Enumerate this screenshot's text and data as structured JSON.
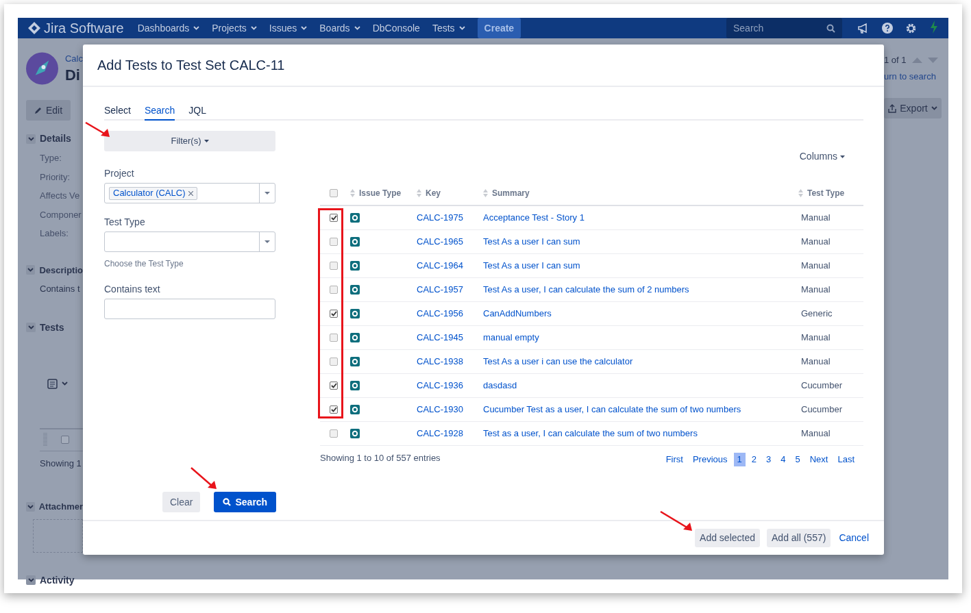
{
  "header": {
    "logo": "Jira Software",
    "nav": [
      {
        "label": "Dashboards",
        "dropdown": true
      },
      {
        "label": "Projects",
        "dropdown": true
      },
      {
        "label": "Issues",
        "dropdown": true
      },
      {
        "label": "Boards",
        "dropdown": true
      },
      {
        "label": "DbConsole",
        "dropdown": false
      },
      {
        "label": "Tests",
        "dropdown": true
      }
    ],
    "create": "Create",
    "search_placeholder": "Search"
  },
  "background": {
    "project_link": "Calc",
    "title": "Di",
    "edit": "Edit",
    "details": "Details",
    "fields": [
      "Type:",
      "Priority:",
      "Affects Ve",
      "Componer",
      "Labels:"
    ],
    "description": "Descriptio",
    "description_text": "Contains t",
    "tests": "Tests",
    "row_checked": false,
    "showing": "Showing 1",
    "attachments": "Attachmer",
    "activity": "Activity",
    "pager": "1 of 1",
    "return_link": "urn to search",
    "export": "Export"
  },
  "dialog": {
    "title": "Add Tests to Test Set CALC-11",
    "tabs": [
      {
        "label": "Select",
        "selected": false
      },
      {
        "label": "Search",
        "selected": true
      },
      {
        "label": "JQL",
        "selected": false
      }
    ],
    "filters_button": "Filter(s)",
    "project": {
      "label": "Project",
      "chip": "Calculator (CALC)"
    },
    "test_type": {
      "label": "Test Type",
      "hint": "Choose the Test Type"
    },
    "contains_text": {
      "label": "Contains text"
    },
    "clear": "Clear",
    "search": "Search",
    "columns_button": "Columns",
    "table": {
      "all_checked": false,
      "columns": [
        "Issue Type",
        "Key",
        "Summary",
        "Test Type"
      ],
      "rows": [
        {
          "checked": true,
          "key": "CALC-1975",
          "summary": "Acceptance Test - Story 1",
          "test_type": "Manual"
        },
        {
          "checked": false,
          "key": "CALC-1965",
          "summary": "Test As a user I can sum",
          "test_type": "Manual"
        },
        {
          "checked": false,
          "key": "CALC-1964",
          "summary": "Test As a user I can sum",
          "test_type": "Manual"
        },
        {
          "checked": false,
          "key": "CALC-1957",
          "summary": "Test As a user, I can calculate the sum of 2 numbers",
          "test_type": "Manual"
        },
        {
          "checked": true,
          "key": "CALC-1956",
          "summary": "CanAddNumbers",
          "test_type": "Generic"
        },
        {
          "checked": false,
          "key": "CALC-1945",
          "summary": "manual empty",
          "test_type": "Manual"
        },
        {
          "checked": false,
          "key": "CALC-1938",
          "summary": "Test As a user i can use the calculator",
          "test_type": "Manual"
        },
        {
          "checked": true,
          "key": "CALC-1936",
          "summary": "dasdasd",
          "test_type": "Cucumber"
        },
        {
          "checked": true,
          "key": "CALC-1930",
          "summary": "Cucumber Test as a user, I can calculate the sum of two numbers",
          "test_type": "Cucumber"
        },
        {
          "checked": false,
          "key": "CALC-1928",
          "summary": "Test as a user, I can calculate the sum of two numbers",
          "test_type": "Manual"
        }
      ]
    },
    "showing": "Showing 1 to 10 of 557 entries",
    "pagination": [
      {
        "label": "First",
        "selected": false
      },
      {
        "label": "Previous",
        "selected": false
      },
      {
        "label": "1",
        "selected": true
      },
      {
        "label": "2",
        "selected": false
      },
      {
        "label": "3",
        "selected": false
      },
      {
        "label": "4",
        "selected": false
      },
      {
        "label": "5",
        "selected": false
      },
      {
        "label": "Next",
        "selected": false
      },
      {
        "label": "Last",
        "selected": false
      }
    ],
    "add_selected": "Add selected",
    "add_all": "Add all (557)",
    "cancel": "Cancel"
  }
}
